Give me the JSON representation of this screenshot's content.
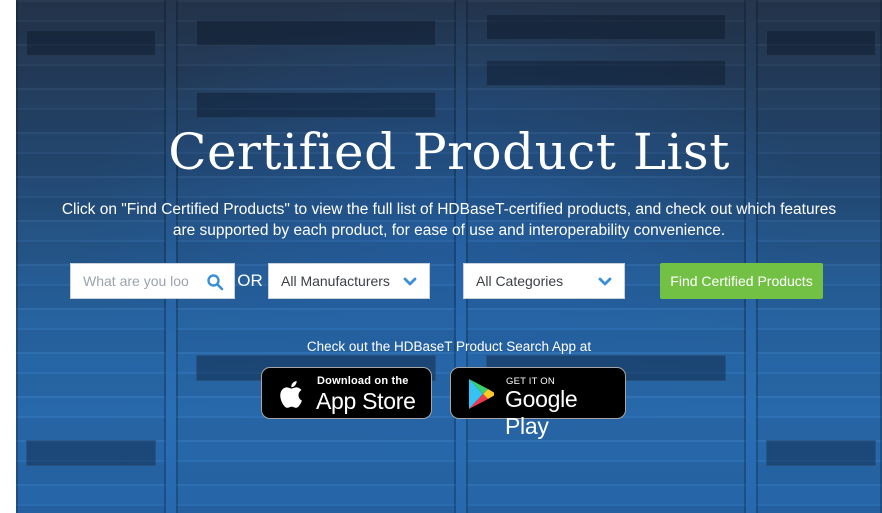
{
  "hero": {
    "title": "Certified Product List",
    "description": "Click on \"Find Certified Products\" to view the full list of HDBaseT-certified products, and check out which features are supported by each product, for ease of use and interoperability convenience."
  },
  "search": {
    "placeholder": "What are you loo",
    "or_label": "OR",
    "manufacturer_select": "All Manufacturers",
    "category_select": "All Categories",
    "find_button": "Find Certified Products"
  },
  "app": {
    "promo_text": "Check out the HDBaseT Product Search App at",
    "apple_small": "Download on the",
    "apple_big": "App Store",
    "google_small": "GET IT ON",
    "google_big": "Google Play"
  },
  "colors": {
    "accent_green": "#72c144",
    "search_icon": "#3a8fd6"
  }
}
